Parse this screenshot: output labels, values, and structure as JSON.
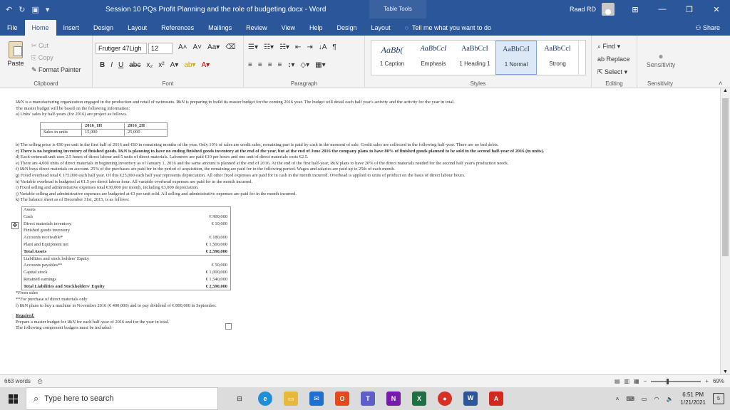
{
  "titlebar": {
    "doc_title": "Session 10 PQs Profit Planning and the role of budgeting.docx  -  Word",
    "context_tab": "Table Tools",
    "user_name": "Raad RD"
  },
  "tabs": {
    "file": "File",
    "home": "Home",
    "insert": "Insert",
    "design": "Design",
    "layout": "Layout",
    "references": "References",
    "mailings": "Mailings",
    "review": "Review",
    "view": "View",
    "help": "Help",
    "design2": "Design",
    "layout2": "Layout",
    "tell_me": "Tell me what you want to do",
    "share": "Share"
  },
  "ribbon": {
    "clipboard": {
      "paste": "Paste",
      "cut": "Cut",
      "copy": "Copy",
      "format_painter": "Format Painter",
      "label": "Clipboard"
    },
    "font": {
      "name": "Frutiger 47Ligh",
      "size": "12",
      "label": "Font"
    },
    "paragraph": {
      "label": "Paragraph"
    },
    "styles": {
      "label": "Styles",
      "items": [
        {
          "preview": "AaBb(",
          "name": "1 Caption"
        },
        {
          "preview": "AaBbCcI",
          "name": "Emphasis"
        },
        {
          "preview": "AaBbCcI",
          "name": "1 Heading 1"
        },
        {
          "preview": "AaBbCcI",
          "name": "1 Normal"
        },
        {
          "preview": "AaBbCcl",
          "name": "Strong"
        }
      ]
    },
    "editing": {
      "find": "Find",
      "replace": "Replace",
      "select": "Select",
      "label": "Editing"
    },
    "sensitivity": {
      "button": "Sensitivity",
      "label": "Sensitivity"
    }
  },
  "doc": {
    "intro1": "I&N is a manufacturing organization engaged in the production and retail of swimsuits. I&N is preparing to build its master budget for the coming 2016 year. The budget will detail each half year's activity and the activity for the year in total.",
    "intro2": "The master budget will be based on the following information:",
    "a": "a)   Units' sales by half-years (for 2016) are project as follows.",
    "sales": {
      "h1_label": "2016_1H",
      "h2_label": "2016_2H",
      "row_label": "Sales in units",
      "h1": "15,000",
      "h2": "25,000"
    },
    "b": "b) The selling price is €90 per unit in the first half of 2016 and €60 in remaining months of the year. Only 10% of sales are credit sales, remaining part is paid by cash in the moment of sale. Credit sales are collected in the following half-year. There are no bad debts.",
    "c": "c)   There is no beginning inventory of finished goods. I&N is planning to have no ending finished goods inventory at the end of the year, but at the end of June 2016 the company plans to have 80% of finished goods planned to be sold in the second half-year of 2016 (in units).",
    "d": "d)   Each swimsuit unit uses 2.5 hours of direct labour and 5 units of direct materials. Labourers are paid €10 per hours and one unit of direct materials costs €2.5.",
    "e": "e)   There are 4,000 units of direct materials in beginning inventory as of January 1, 2016 and the same amount is planned at the end of 2016. At the end of the first half-year, I&N plans to have 20% of the direct materials needed for the second half year's production needs.",
    "f": "f)   I&N buys direct materials on account. 25% of the purchases are paid for in the period of acquisition, the remaining are paid for in the following period. Wages and salaries are paid up to 25th of each month.",
    "g": "g)   Fixed overhead total € 175,000 each half year. Of this €25,000 each half year represents depreciation. All other fixed expenses are paid for in cash in the month incurred. Overhead is applied to units of product on the basis of direct labour hours.",
    "h": "h)   Variable overhead is budgeted at €1.5 per direct labour hour. All variable overhead expenses are paid for in the month incurred.",
    "i": "i)   Fixed selling and administrative expenses total €30,000 per month, including €3,000 depreciation.",
    "j": "j)   Variable selling and administrative expenses are budgeted at €3 per unit sold. All selling and administrative expenses are paid for in the month incurred.",
    "k": "k)   The balance sheet as of December 31st, 2015, is as follows:",
    "balance": [
      {
        "label": "Assets",
        "amount": "",
        "bold": false
      },
      {
        "label": "Cash",
        "amount": "€ 900,000",
        "bold": false
      },
      {
        "label": "Direct materials inventory",
        "amount": "€ 10,000",
        "bold": false
      },
      {
        "label": "Finished goods inventory",
        "amount": "",
        "bold": false
      },
      {
        "label": "Accounts receivable*",
        "amount": "€ 180,000",
        "bold": false
      },
      {
        "label": "Plant and Equipment net",
        "amount": "€ 1,500,000",
        "bold": false
      },
      {
        "label": "Total Assets",
        "amount": "€ 2,590,000",
        "bold": true
      },
      {
        "label": "Liabilities and stock holders' Equity",
        "amount": "",
        "bold": false
      },
      {
        "label": "Accounts payables**",
        "amount": "€ 50,000",
        "bold": false
      },
      {
        "label": "Capital stock",
        "amount": "€ 1,000,000",
        "bold": false
      },
      {
        "label": "Retained earnings",
        "amount": "€ 1,540,000",
        "bold": false
      },
      {
        "label": "Total Liabilities and Stockholders' Equity",
        "amount": "€ 2,590,000",
        "bold": true
      }
    ],
    "note1": "*From sales",
    "note2": "**For purchase of direct materials only",
    "l": "l) I&N plans to buy a machine in November 2016 (€ 400,000) and to pay dividend of € 800,000 in September.",
    "required": "Required:",
    "req1": "Prepare a master budget for I&N for each half-year of 2016 and for the year in total.",
    "req2": "The following component budgets must be included:"
  },
  "status": {
    "words": "663 words",
    "zoom": "69%"
  },
  "taskbar": {
    "search_placeholder": "Type here to search",
    "time": "6:51 PM",
    "date": "1/21/2021",
    "notifications": "5"
  }
}
